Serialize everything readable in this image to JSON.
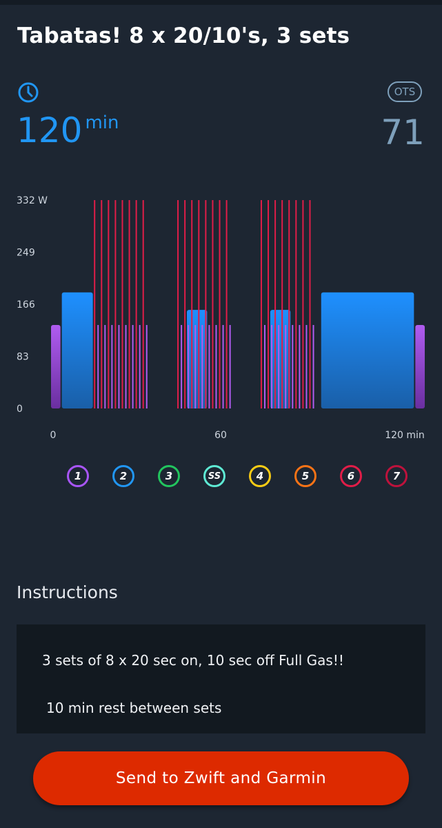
{
  "workout": {
    "title": "Tabatas! 8 x 20/10's, 3 sets",
    "duration_value": "120",
    "duration_unit": "min",
    "ots_label": "OTS",
    "ots_value": "71"
  },
  "icons": {
    "duration": "clock-icon",
    "ots": "ots-badge"
  },
  "colors": {
    "accent": "#2196f3",
    "ots": "#7ea0bb",
    "send_button": "#dd2a00",
    "zone1": "#a855f7",
    "zone2": "#2196f3",
    "zone3": "#22c55e",
    "zone_ss": "#5eead4",
    "zone4": "#facc15",
    "zone5": "#f97316",
    "zone6": "#e11d48",
    "zone7": "#be123c"
  },
  "chart_data": {
    "type": "bar",
    "title": "",
    "xlabel": "",
    "ylabel": "",
    "y_unit": "W",
    "y_ticks": [
      "332 W",
      "249",
      "166",
      "83",
      "0"
    ],
    "y_tick_values": [
      332,
      249,
      166,
      83,
      0
    ],
    "x_tick_labels": [
      "0",
      "60",
      "120 min"
    ],
    "x_tick_values": [
      0,
      60,
      120
    ],
    "ylim": [
      0,
      332
    ],
    "xlim": [
      0,
      120
    ],
    "blocks": [
      {
        "start": 0,
        "end": 3.5,
        "watts": 133,
        "zone": 1
      },
      {
        "start": 3.5,
        "end": 14,
        "watts": 185,
        "zone": 2
      },
      {
        "start": 44,
        "end": 51,
        "watts": 157,
        "zone": 2
      },
      {
        "start": 71,
        "end": 78,
        "watts": 157,
        "zone": 2
      },
      {
        "start": 87.5,
        "end": 118,
        "watts": 185,
        "zone": 2
      },
      {
        "start": 118,
        "end": 121.5,
        "watts": 133,
        "zone": 1
      }
    ],
    "interval_sets": [
      {
        "start": 14,
        "end": 32,
        "reps": 8,
        "on_watts": 332,
        "off_watts": 133
      },
      {
        "start": 41,
        "end": 59,
        "reps": 8,
        "on_watts": 332,
        "off_watts": 133
      },
      {
        "start": 68,
        "end": 86,
        "reps": 8,
        "on_watts": 332,
        "off_watts": 133
      }
    ]
  },
  "zones": [
    {
      "label": "1",
      "color": "#a855f7"
    },
    {
      "label": "2",
      "color": "#2196f3"
    },
    {
      "label": "3",
      "color": "#22c55e"
    },
    {
      "label": "SS",
      "color": "#5eead4"
    },
    {
      "label": "4",
      "color": "#facc15"
    },
    {
      "label": "5",
      "color": "#f97316"
    },
    {
      "label": "6",
      "color": "#e11d48"
    },
    {
      "label": "7",
      "color": "#be123c"
    }
  ],
  "instructions": {
    "heading": "Instructions",
    "line1": "3 sets of 8 x 20 sec on, 10 sec off Full Gas!!",
    "line2": "10 min rest between sets"
  },
  "actions": {
    "send_label": "Send to Zwift and Garmin"
  }
}
